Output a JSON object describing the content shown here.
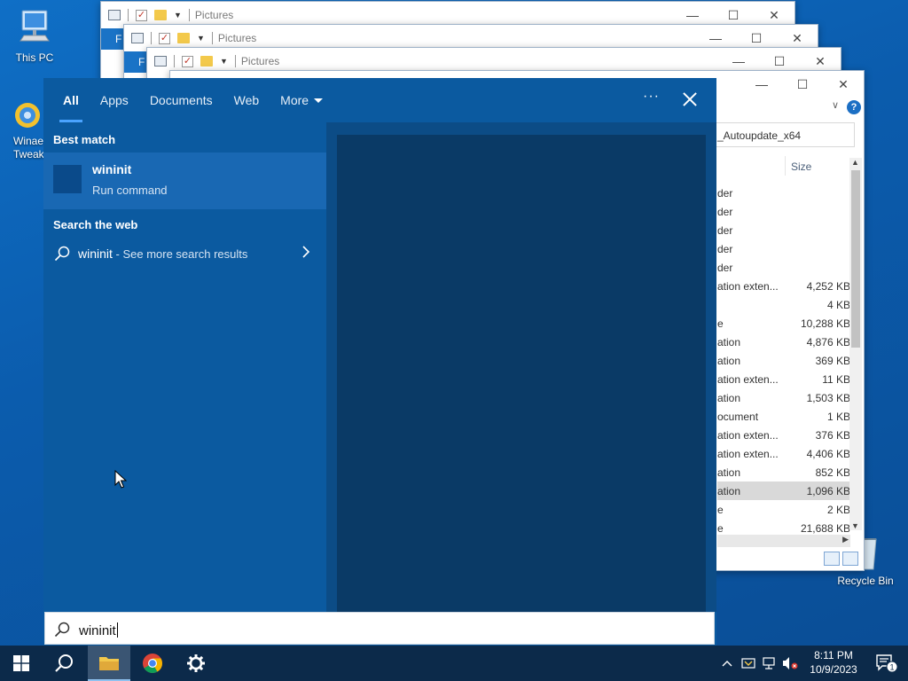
{
  "desktop": {
    "icons": {
      "this_pc": "This PC",
      "winaero_line1": "Winae",
      "winaero_line2": "Tweak",
      "recycle_bin": "Recycle Bin"
    }
  },
  "windows": {
    "explorer_title": "Pictures",
    "ribbon_tab": "F",
    "front": {
      "path_text": "_Autoupdate_x64",
      "size_header": "Size",
      "rows": [
        {
          "type": "der",
          "size": ""
        },
        {
          "type": "der",
          "size": ""
        },
        {
          "type": "der",
          "size": ""
        },
        {
          "type": "der",
          "size": ""
        },
        {
          "type": "der",
          "size": ""
        },
        {
          "type": "ation exten...",
          "size": "4,252 KB"
        },
        {
          "type": "",
          "size": "4 KB"
        },
        {
          "type": "e",
          "size": "10,288 KB"
        },
        {
          "type": "ation",
          "size": "4,876 KB"
        },
        {
          "type": "ation",
          "size": "369 KB"
        },
        {
          "type": "ation exten...",
          "size": "11 KB"
        },
        {
          "type": "ation",
          "size": "1,503 KB"
        },
        {
          "type": "ocument",
          "size": "1 KB"
        },
        {
          "type": "ation exten...",
          "size": "376 KB"
        },
        {
          "type": "ation exten...",
          "size": "4,406 KB"
        },
        {
          "type": "ation",
          "size": "852 KB"
        },
        {
          "type": "ation",
          "size": "1,096 KB",
          "selected": true
        },
        {
          "type": "e",
          "size": "2 KB"
        },
        {
          "type": "e",
          "size": "21,688 KB"
        }
      ]
    }
  },
  "search": {
    "tabs": [
      "All",
      "Apps",
      "Documents",
      "Web",
      "More"
    ],
    "active_tab": "All",
    "best_match_heading": "Best match",
    "best_match": {
      "name": "wininit",
      "type": "Run command"
    },
    "search_web_heading": "Search the web",
    "web_result": {
      "query": "wininit",
      "suffix": " - See more search results"
    },
    "query": "wininit"
  },
  "taskbar": {
    "clock_time": "8:11 PM",
    "clock_date": "10/9/2023",
    "notification_count": "1"
  },
  "colors": {
    "accent": "#0b5aa0",
    "selected_item": "#1968b3",
    "preview_pane": "#0a3a66",
    "taskbar": "#0c2a4a"
  }
}
